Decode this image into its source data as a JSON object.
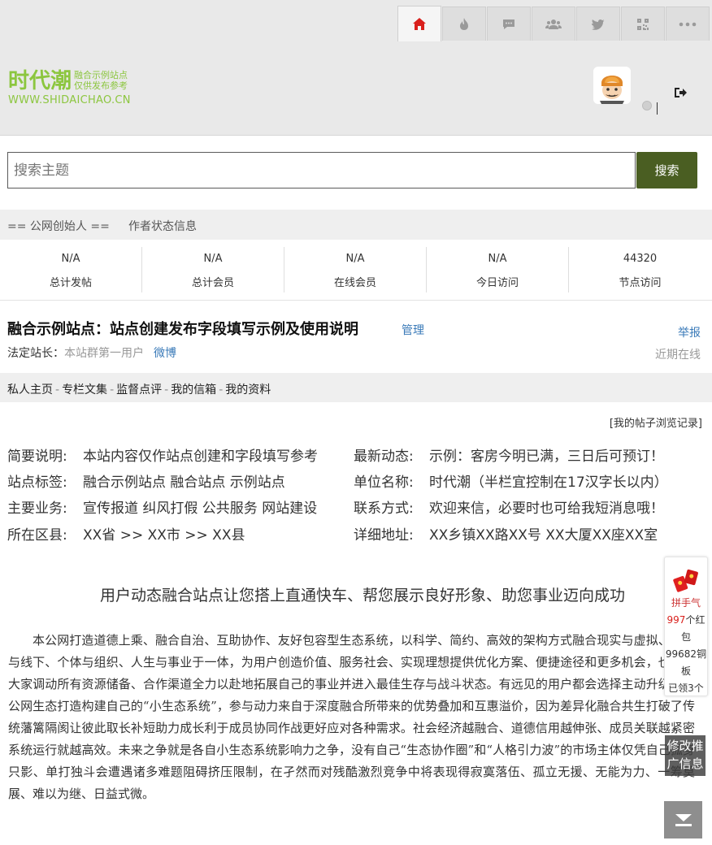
{
  "header": {
    "tabs": [
      {
        "icon": "home-icon",
        "active": true
      },
      {
        "icon": "fire-icon",
        "active": false
      },
      {
        "icon": "chat-icon",
        "active": false
      },
      {
        "icon": "users-icon",
        "active": false
      },
      {
        "icon": "twitter-icon",
        "active": false
      },
      {
        "icon": "qrcode-icon",
        "active": false
      },
      {
        "icon": "more-icon",
        "active": false
      }
    ],
    "logo": {
      "main": "时代潮",
      "sub1": "融合示例站点",
      "sub2": "仅供发布参考",
      "url": "WWW.SHIDAICHAO.CN"
    },
    "accent_color": "#d9201c",
    "logo_color": "#8cc63f"
  },
  "search": {
    "placeholder": "搜索主题",
    "button": "搜索",
    "button_color": "#4a5e22"
  },
  "founder_bar": {
    "left": "== 公网创始人 ==",
    "right": "作者状态信息"
  },
  "stats": [
    {
      "value": "N/A",
      "label": "总计发帖"
    },
    {
      "value": "N/A",
      "label": "总计会员"
    },
    {
      "value": "N/A",
      "label": "在线会员"
    },
    {
      "value": "N/A",
      "label": "今日访问"
    },
    {
      "value": "44320",
      "label": "节点访问"
    }
  ],
  "site": {
    "title": "融合示例站点：站点创建发布字段填写示例及使用说明",
    "manage": "管理",
    "report": "举报",
    "owner_label": "法定站长：",
    "owner_value": "本站群第一用户",
    "weibo": "微博",
    "status": "近期在线"
  },
  "nav": [
    "私人主页",
    "专栏文集",
    "监督点评",
    "我的信箱",
    "我的资料"
  ],
  "nav_sep": "-",
  "history_link": "[我的帖子浏览记录]",
  "info": [
    {
      "k1": "简要说明:",
      "v1": "本站内容仅作站点创建和字段填写参考",
      "k2": "最新动态:",
      "v2": "示例：客房今明已满，三日后可预订！"
    },
    {
      "k1": "站点标签:",
      "v1": "融合示例站点 融合站点 示例站点",
      "k2": "单位名称:",
      "v2": "时代潮（半栏宜控制在17汉字长以内）"
    },
    {
      "k1": "主要业务:",
      "v1": "宣传报道 纠风打假 公共服务 网站建设",
      "k2": "联系方式:",
      "v2": "欢迎来信，必要时也可给我短消息哦！"
    },
    {
      "k1": "所在区县:",
      "v1": "XX省 >> XX市 >> XX县",
      "k2": "详细地址:",
      "v2": "XX乡镇XX路XX号 XX大厦XX座XX室"
    }
  ],
  "slogan": "用户动态融合站点让您搭上直通快车、帮您展示良好形象、助您事业迈向成功",
  "body_text": "本公网打造道德上乘、融合自治、互助协作、友好包容型生态系统，以科学、简约、高效的架构方式融合现实与虚拟、线上与线下、个体与组织、人生与事业于一体，为用户创造价值、服务社会、实现理想提供优化方案、便捷途径和更多机会，也方便大家调动所有资源储备、合作渠道全力以赴地拓展自己的事业并进入最佳生存与战斗状态。有远见的用户都会选择主动升级融入公网生态打造构建自己的“小生态系统”，参与动力来自于深度融合所带来的优势叠加和互惠溢价，因为差异化融合共生打破了传统藩篱隔阂让彼此取长补短助力成长利于成员协同作战更好应对各种需求。社会经济越融合、道德信用越伸张、成员关联越紧密系统运行就越高效。未来之争就是各自小生态系统影响力之争，没有自己“生态协作圈”和“人格引力波”的市场主体仅凭自己孤身只影、单打独斗会遭遇诸多难题阻碍挤压限制，在孑然而对残酷激烈竞争中将表现得寂寞落伍、孤立无援、无能为力、一筹莫展、难以为继、日益式微。",
  "redpacket": {
    "title": "拼手气",
    "count": "997",
    "unit": "个红包",
    "coins": "99682",
    "coins_unit": "铜板",
    "claimed": "已领3个"
  },
  "edit_ad": "修改推广信息"
}
